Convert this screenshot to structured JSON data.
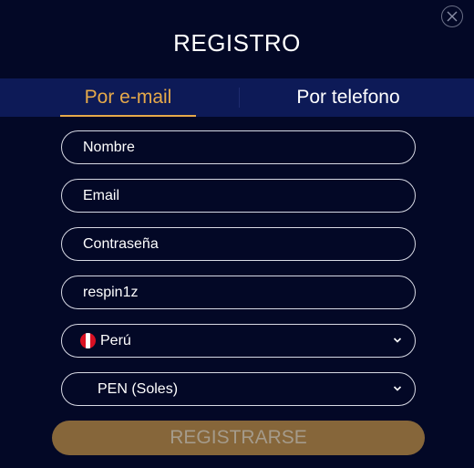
{
  "modal": {
    "title": "REGISTRO",
    "close_icon": "close-icon"
  },
  "tabs": [
    {
      "label": "Por e-mail",
      "active": true
    },
    {
      "label": "Por telefono",
      "active": false
    }
  ],
  "form": {
    "name_placeholder": "Nombre",
    "email_placeholder": "Email",
    "password_placeholder": "Contraseña",
    "promo_value": "respin1z",
    "country": {
      "value": "Perú",
      "flag_icon": "peru-flag-icon"
    },
    "currency": {
      "value": "PEN (Soles)"
    },
    "submit_label": "REGISTRARSE"
  },
  "colors": {
    "background": "#030826",
    "tab_bar": "#0d1a57",
    "accent": "#e6a94a",
    "button": "#86663a",
    "flag_red": "#d91023"
  }
}
